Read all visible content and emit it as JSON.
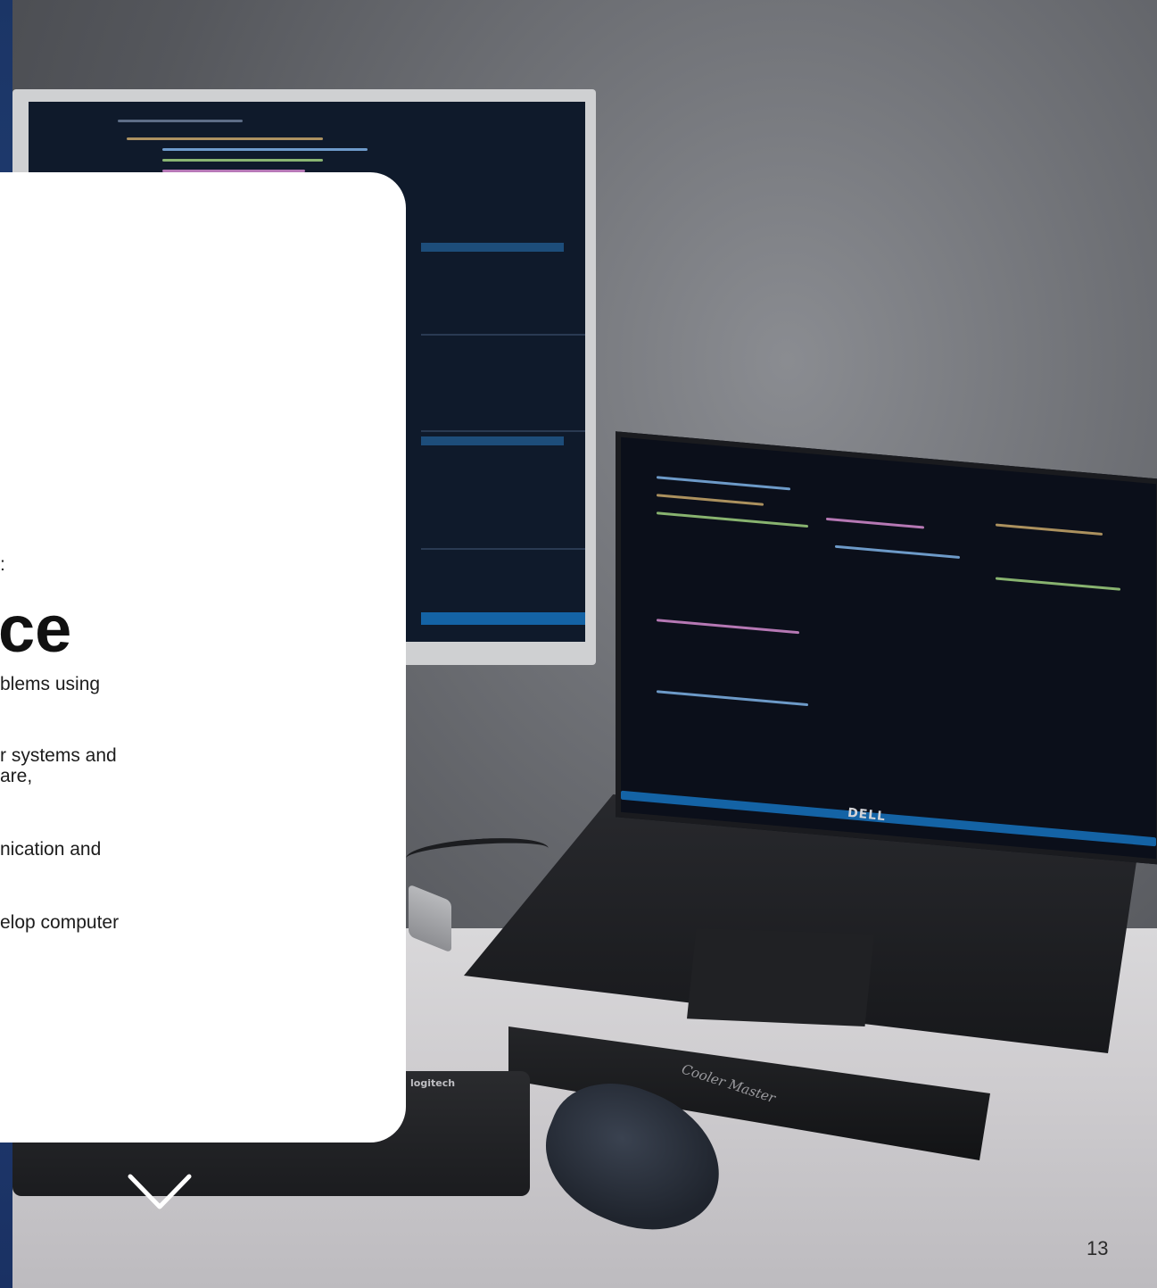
{
  "slide": {
    "title_fragment": "ce",
    "lines": [
      ":",
      "blems using",
      "r systems and",
      "are,",
      "nication and",
      "elop computer"
    ],
    "page_number": "13"
  },
  "photo": {
    "laptop_brand": "DELL",
    "keyboard_brand": "logitech",
    "stand_label": "Cooler Master"
  },
  "navigation": {
    "next_icon": "chevron-down-icon"
  },
  "colors": {
    "card": "#ffffff",
    "accent_strip": "#23427a",
    "editor_bg": "#0f1a2b",
    "status_bar": "#1463a5"
  }
}
